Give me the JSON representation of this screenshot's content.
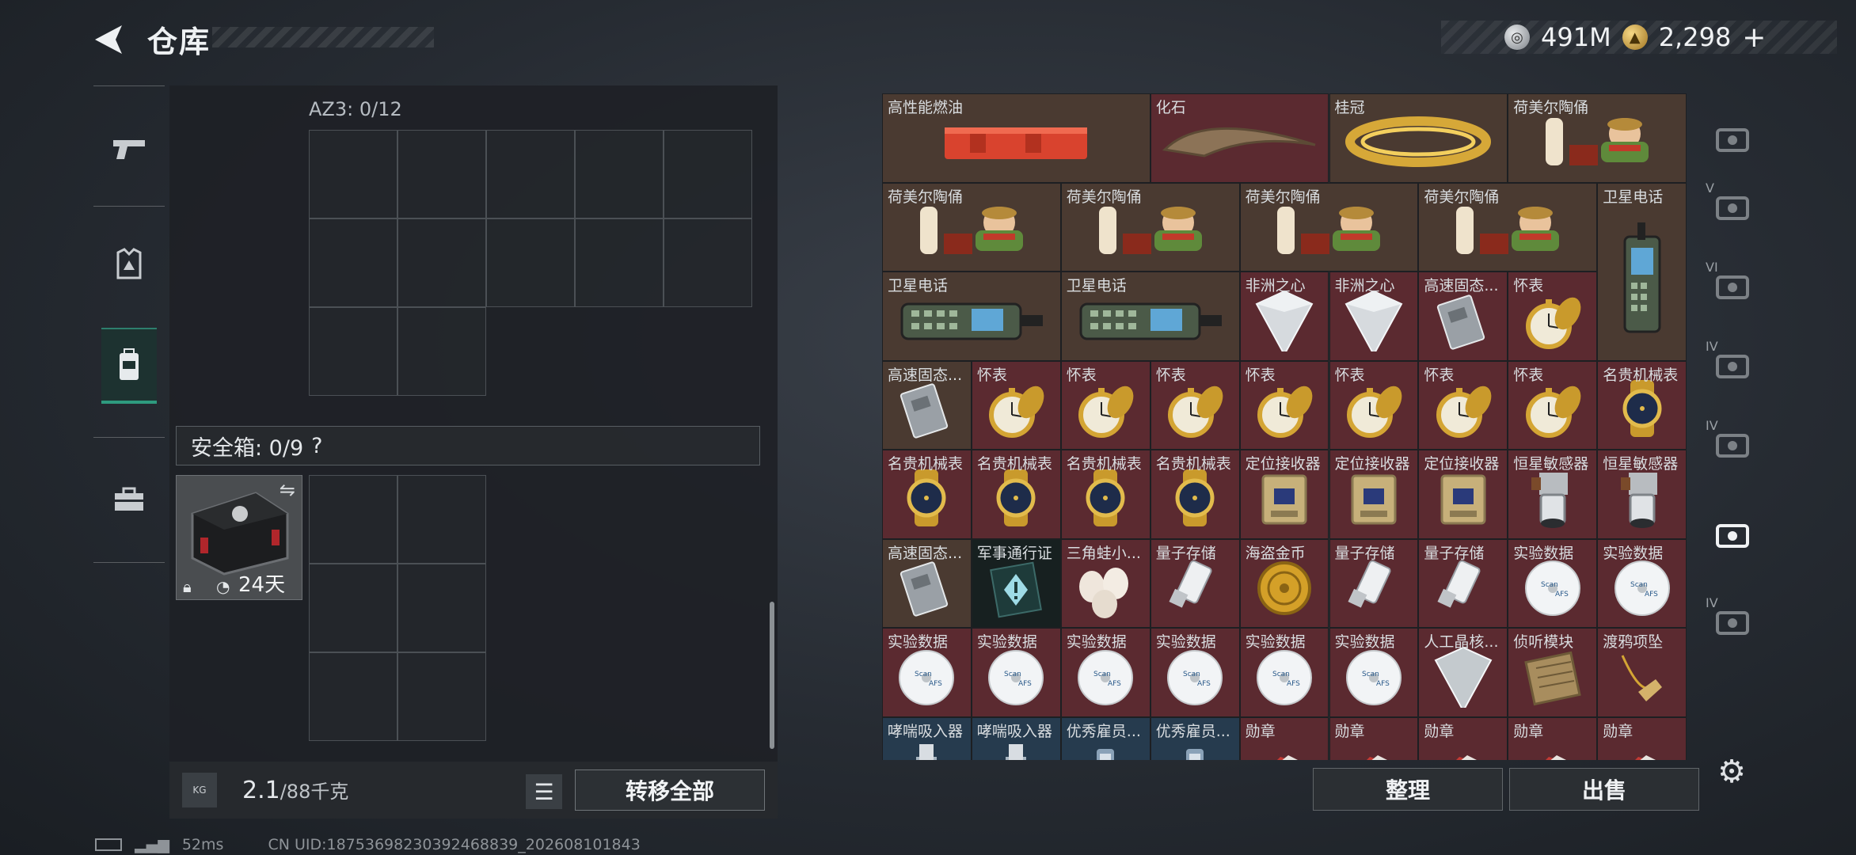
{
  "header": {
    "title": "仓库",
    "currency": [
      {
        "icon": "silver-coin-icon",
        "value": "491M"
      },
      {
        "icon": "gold-coin-icon",
        "value": "2,298"
      }
    ],
    "add_symbol": "+"
  },
  "left_nav": [
    "pistol-icon",
    "armor-icon",
    "backpack-icon",
    "toolbox-icon"
  ],
  "container": {
    "az3_label": "AZ3: 0/12",
    "safe_label": "安全箱: 0/9",
    "safe_help": "?",
    "safe_timer": "24天"
  },
  "weight": {
    "value": "2.1",
    "max": "/88千克",
    "icon_text": "KG"
  },
  "buttons": {
    "transfer_all": "转移全部",
    "sort": "整理",
    "sell": "出售"
  },
  "items": [
    {
      "label": "高性能燃油",
      "bg": "brown",
      "icon": "fuel-case-icon"
    },
    {
      "label": "化石",
      "bg": "red",
      "icon": "fossil-claw-icon"
    },
    {
      "label": "桂冠",
      "bg": "brown",
      "icon": "laurel-crown-icon"
    },
    {
      "label": "荷美尔陶俑",
      "bg": "brown",
      "icon": "figurine-icon"
    },
    {
      "label": "荷美尔陶俑",
      "bg": "brown",
      "icon": "figurine-icon"
    },
    {
      "label": "荷美尔陶俑",
      "bg": "brown",
      "icon": "figurine-icon"
    },
    {
      "label": "荷美尔陶俑",
      "bg": "brown",
      "icon": "figurine-icon"
    },
    {
      "label": "荷美尔陶俑",
      "bg": "brown",
      "icon": "figurine-icon"
    },
    {
      "label": "卫星电话",
      "bg": "brown",
      "icon": "satellite-phone-icon"
    },
    {
      "label": "卫星电话",
      "bg": "brown",
      "icon": "satellite-phone-icon"
    },
    {
      "label": "卫星电话",
      "bg": "brown",
      "icon": "satellite-phone-icon"
    },
    {
      "label": "非洲之心",
      "bg": "red",
      "icon": "diamond-icon"
    },
    {
      "label": "非洲之心",
      "bg": "red",
      "icon": "diamond-icon"
    },
    {
      "label": "高速固态...",
      "bg": "red",
      "icon": "ssd-icon"
    },
    {
      "label": "怀表",
      "bg": "red",
      "icon": "pocket-watch-icon"
    },
    {
      "label": "高速固态...",
      "bg": "brown",
      "icon": "ssd-icon"
    },
    {
      "label": "怀表",
      "bg": "red",
      "icon": "pocket-watch-icon"
    },
    {
      "label": "怀表",
      "bg": "red",
      "icon": "pocket-watch-icon"
    },
    {
      "label": "怀表",
      "bg": "red",
      "icon": "pocket-watch-icon"
    },
    {
      "label": "怀表",
      "bg": "red",
      "icon": "pocket-watch-icon"
    },
    {
      "label": "怀表",
      "bg": "red",
      "icon": "pocket-watch-icon"
    },
    {
      "label": "怀表",
      "bg": "red",
      "icon": "pocket-watch-icon"
    },
    {
      "label": "怀表",
      "bg": "red",
      "icon": "pocket-watch-icon"
    },
    {
      "label": "名贵机械表",
      "bg": "red",
      "icon": "wristwatch-icon"
    },
    {
      "label": "名贵机械表",
      "bg": "red",
      "icon": "wristwatch-icon"
    },
    {
      "label": "名贵机械表",
      "bg": "red",
      "icon": "wristwatch-icon"
    },
    {
      "label": "名贵机械表",
      "bg": "red",
      "icon": "wristwatch-icon"
    },
    {
      "label": "名贵机械表",
      "bg": "red",
      "icon": "wristwatch-icon"
    },
    {
      "label": "定位接收器",
      "bg": "red",
      "icon": "gps-receiver-icon"
    },
    {
      "label": "定位接收器",
      "bg": "red",
      "icon": "gps-receiver-icon"
    },
    {
      "label": "定位接收器",
      "bg": "red",
      "icon": "gps-receiver-icon"
    },
    {
      "label": "恒星敏感器",
      "bg": "red",
      "icon": "star-sensor-icon"
    },
    {
      "label": "恒星敏感器",
      "bg": "red",
      "icon": "star-sensor-icon"
    },
    {
      "label": "高速固态...",
      "bg": "brown",
      "icon": "ssd-icon"
    },
    {
      "label": "军事通行证",
      "bg": "dark",
      "icon": "military-pass-icon"
    },
    {
      "label": "三角蛙小...",
      "bg": "red",
      "icon": "eggs-icon"
    },
    {
      "label": "量子存储",
      "bg": "red",
      "icon": "usb-drive-icon"
    },
    {
      "label": "海盗金币",
      "bg": "red",
      "icon": "gold-coin-item-icon"
    },
    {
      "label": "量子存储",
      "bg": "red",
      "icon": "usb-drive-icon"
    },
    {
      "label": "量子存储",
      "bg": "red",
      "icon": "usb-drive-icon"
    },
    {
      "label": "实验数据",
      "bg": "red",
      "icon": "data-disc-icon"
    },
    {
      "label": "实验数据",
      "bg": "red",
      "icon": "data-disc-icon"
    },
    {
      "label": "实验数据",
      "bg": "red",
      "icon": "data-disc-icon"
    },
    {
      "label": "实验数据",
      "bg": "red",
      "icon": "data-disc-icon"
    },
    {
      "label": "实验数据",
      "bg": "red",
      "icon": "data-disc-icon"
    },
    {
      "label": "实验数据",
      "bg": "red",
      "icon": "data-disc-icon"
    },
    {
      "label": "实验数据",
      "bg": "red",
      "icon": "data-disc-icon"
    },
    {
      "label": "实验数据",
      "bg": "red",
      "icon": "data-disc-icon"
    },
    {
      "label": "人工晶核...",
      "bg": "red",
      "icon": "crystal-icon"
    },
    {
      "label": "侦听模块",
      "bg": "red",
      "icon": "listening-module-icon"
    },
    {
      "label": "渡鸦项坠",
      "bg": "red",
      "icon": "raven-pendant-icon"
    },
    {
      "label": "哮喘吸入器",
      "bg": "blue",
      "icon": "inhaler-icon"
    },
    {
      "label": "哮喘吸入器",
      "bg": "blue",
      "icon": "inhaler-icon"
    },
    {
      "label": "优秀雇员...",
      "bg": "blue",
      "icon": "badge-icon"
    },
    {
      "label": "优秀雇员...",
      "bg": "blue",
      "icon": "badge-icon"
    },
    {
      "label": "勋章",
      "bg": "red",
      "icon": "medal-icon"
    },
    {
      "label": "勋章",
      "bg": "red",
      "icon": "medal-icon"
    },
    {
      "label": "勋章",
      "bg": "red",
      "icon": "medal-icon"
    },
    {
      "label": "勋章",
      "bg": "red",
      "icon": "medal-icon"
    },
    {
      "label": "勋章",
      "bg": "red",
      "icon": "medal-icon"
    }
  ],
  "right_rail": [
    "helmet-slot-icon",
    "V-armor-slot-icon",
    "VI-armor-slot-icon",
    "IV-armor-slot-icon",
    "IV-medkit-slot-icon",
    "ammo-slot-icon",
    "IV-storage-slot-icon"
  ],
  "right_rail_labels": [
    "",
    "V",
    "VI",
    "IV",
    "IV",
    "",
    "IV"
  ],
  "footer": {
    "ping": "52ms",
    "uid": "CN UID:18753698230392468839_202608101843"
  }
}
